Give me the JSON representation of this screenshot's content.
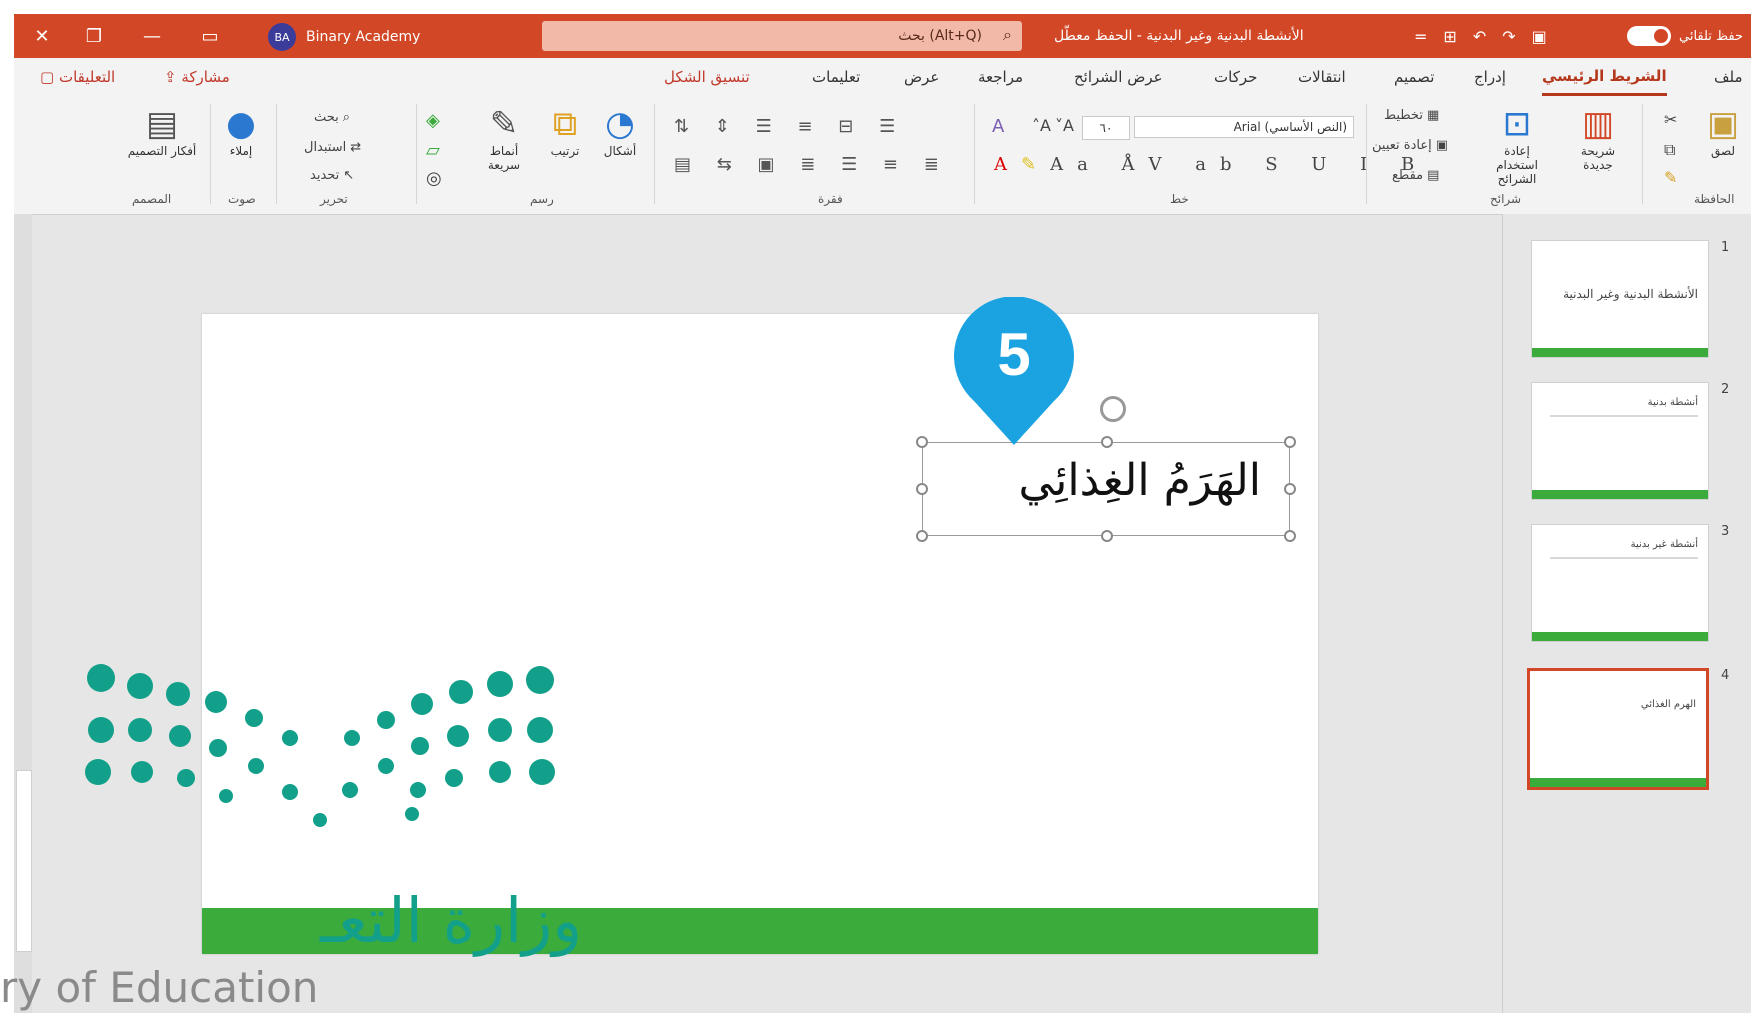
{
  "titlebar": {
    "account_name": "Binary Academy",
    "account_initials": "BA",
    "search_placeholder": "بحث (Alt+Q)",
    "doc_title": "الأنشطة البدنية وغير البدنية - الحفظ معطّل",
    "autosave_label": "حفظ تلقائي",
    "close_glyph": "✕",
    "restore_glyph": "❐",
    "minimize_glyph": "—",
    "layout_glyph": "▭"
  },
  "tabs": {
    "file": "ملف",
    "home": "الشريط الرئيسي",
    "insert": "إدراج",
    "design": "تصميم",
    "transitions": "انتقالات",
    "animations": "حركات",
    "slideshow": "عرض الشرائح",
    "review": "مراجعة",
    "view": "عرض",
    "help": "تعليمات",
    "shape_format": "تنسيق الشكل",
    "share": "مشاركة",
    "comments": "التعليقات"
  },
  "ribbon": {
    "clipboard": {
      "paste": "لصق",
      "label": "الحافظة"
    },
    "slides": {
      "new_slide": "شريحة جديدة",
      "reuse": "إعادة استخدام الشرائح",
      "layout": "تخطيط",
      "reset": "إعادة تعيين",
      "section": "مقطع",
      "label": "شرائح"
    },
    "font": {
      "name": "Arial (النص الأساسي)",
      "size": "٦٠",
      "label": "خط"
    },
    "paragraph": {
      "label": "فقرة"
    },
    "drawing": {
      "shapes": "أشكال",
      "arrange": "ترتيب",
      "quick_styles": "أنماط سريعة",
      "label": "رسم"
    },
    "editing": {
      "find": "بحث",
      "replace": "استبدال",
      "select": "تحديد",
      "label": "تحرير"
    },
    "voice": {
      "dictate": "إملاء",
      "label": "صوت"
    },
    "designer": {
      "ideas": "أفكار التصميم",
      "label": "المصمم"
    }
  },
  "slide": {
    "title_text": "الهَرَمُ الغِذائِي"
  },
  "marker": {
    "step": "5",
    "color": "#1aa3e0"
  },
  "thumbnails": [
    {
      "num": "1",
      "text": "الأنشطة البدنية وغير البدنية"
    },
    {
      "num": "2",
      "text": "أنشطة بدنية"
    },
    {
      "num": "3",
      "text": "أنشطة غير بدنية"
    },
    {
      "num": "4",
      "text": "الهرم الغذائي"
    }
  ],
  "watermark": {
    "arabic": "وزارة التعـ",
    "english": "ry of Education"
  },
  "colors": {
    "accent": "#d24726",
    "slide_bar": "#3bab3c",
    "logo_teal": "#12a08a"
  }
}
